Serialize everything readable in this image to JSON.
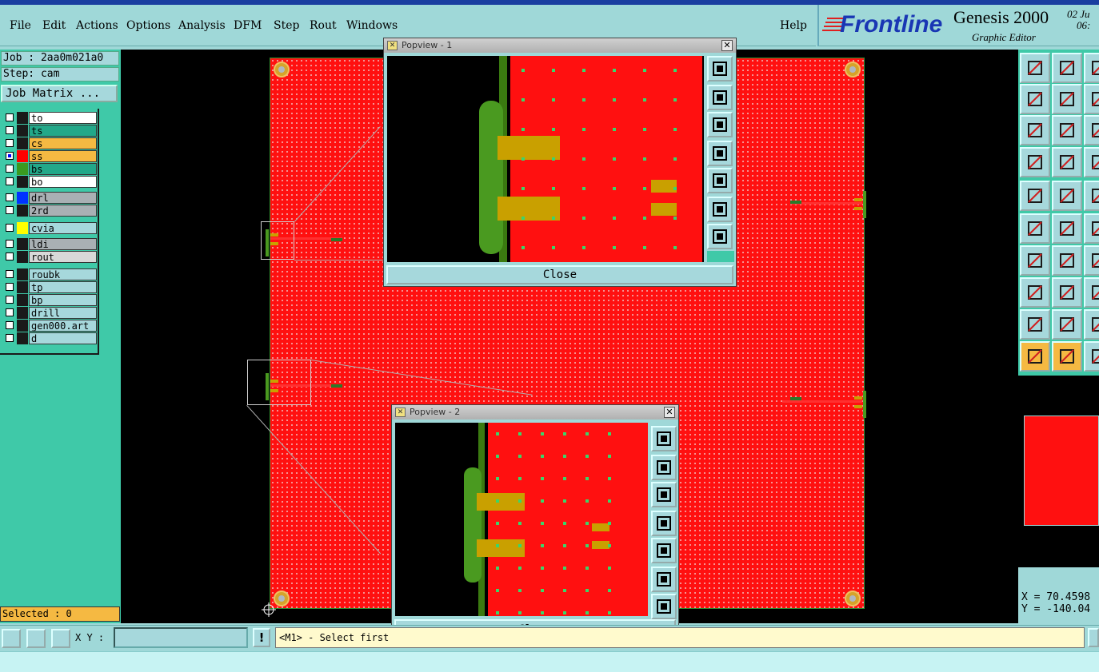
{
  "menubar": {
    "items": [
      "File",
      "Edit",
      "Actions",
      "Options",
      "Analysis",
      "DFM",
      "Step",
      "Rout",
      "Windows"
    ],
    "help": "Help"
  },
  "branding": {
    "logo": "Frontline",
    "app_name": "Genesis 2000",
    "app_sub": "Graphic Editor",
    "date_line1": "02  Ju",
    "date_line2": "06:"
  },
  "job": {
    "job_label": "Job : 2aa0m021a0",
    "step_label": "Step: cam",
    "matrix_button": "Job Matrix ..."
  },
  "layers": [
    {
      "name": "to",
      "color": "#ffffff",
      "sw": "#1a1a1a",
      "checked": false
    },
    {
      "name": "ts",
      "color": "#22a889",
      "sw": "#1a1a1a",
      "checked": false
    },
    {
      "name": "cs",
      "color": "#f5b942",
      "sw": "#1a1a1a",
      "checked": false
    },
    {
      "name": "ss",
      "color": "#f5b942",
      "sw": "#ff0000",
      "checked": true
    },
    {
      "name": "bs",
      "color": "#22a889",
      "sw": "#3a9a20",
      "checked": false
    },
    {
      "name": "bo",
      "color": "#ffffff",
      "sw": "#1a1a1a",
      "checked": false
    },
    {
      "name": "drl",
      "color": "#a9b0b4",
      "sw": "#0033ff",
      "checked": false
    },
    {
      "name": "2rd",
      "color": "#a9b0b4",
      "sw": "#1a1a1a",
      "checked": false
    },
    {
      "name": "cvia",
      "color": "#a6d8dc",
      "sw": "#ffff00",
      "checked": false
    },
    {
      "name": "ldi",
      "color": "#a9b0b4",
      "sw": "#1a1a1a",
      "checked": false
    },
    {
      "name": "rout",
      "color": "#d8d8d8",
      "sw": "#1a1a1a",
      "checked": false
    },
    {
      "name": "roubk",
      "color": "#a6d8dc",
      "sw": "#1a1a1a",
      "checked": false
    },
    {
      "name": "tp",
      "color": "#a6d8dc",
      "sw": "#1a1a1a",
      "checked": false
    },
    {
      "name": "bp",
      "color": "#a6d8dc",
      "sw": "#1a1a1a",
      "checked": false
    },
    {
      "name": "drill",
      "color": "#a6d8dc",
      "sw": "#1a1a1a",
      "checked": false
    },
    {
      "name": "gen000.art",
      "color": "#a6d8dc",
      "sw": "#1a1a1a",
      "checked": false
    },
    {
      "name": "d",
      "color": "#a6d8dc",
      "sw": "#1a1a1a",
      "checked": false
    }
  ],
  "selected": "Selected : 0",
  "popview1": {
    "title": "Popview - 1",
    "close": "Close"
  },
  "popview2": {
    "title": "Popview - 2",
    "close": "Close"
  },
  "coords": {
    "x": "X = 70.4598",
    "y": "Y = -140.04"
  },
  "bottom": {
    "xy_label": "X Y :",
    "xy_value": "",
    "exclaim": "!",
    "status": "<M1> - Select first"
  },
  "colors": {
    "board": "#ff1010",
    "panel": "#3fc9a8",
    "chrome": "#9fd8d8",
    "highlight": "#f5b942"
  }
}
